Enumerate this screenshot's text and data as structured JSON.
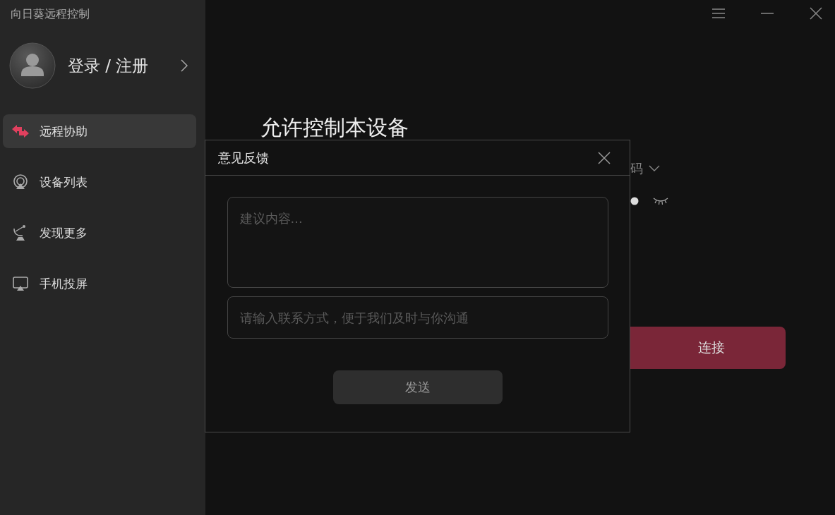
{
  "app_title": "向日葵远程控制",
  "account": {
    "label": "登录 / 注册"
  },
  "nav": [
    {
      "label": "远程协助",
      "selected": true
    },
    {
      "label": "设备列表",
      "selected": false
    },
    {
      "label": "发现更多",
      "selected": false
    },
    {
      "label": "手机投屏",
      "selected": false
    }
  ],
  "main": {
    "heading": "允许控制本设备",
    "code_label": "码",
    "connect_button": "连接"
  },
  "dialog": {
    "title": "意见反馈",
    "fields": [
      {
        "kind": "textarea",
        "placeholder": "建议内容..."
      },
      {
        "kind": "input",
        "placeholder": "请输入联系方式，便于我们及时与你沟通"
      }
    ],
    "send_button": "发送"
  }
}
